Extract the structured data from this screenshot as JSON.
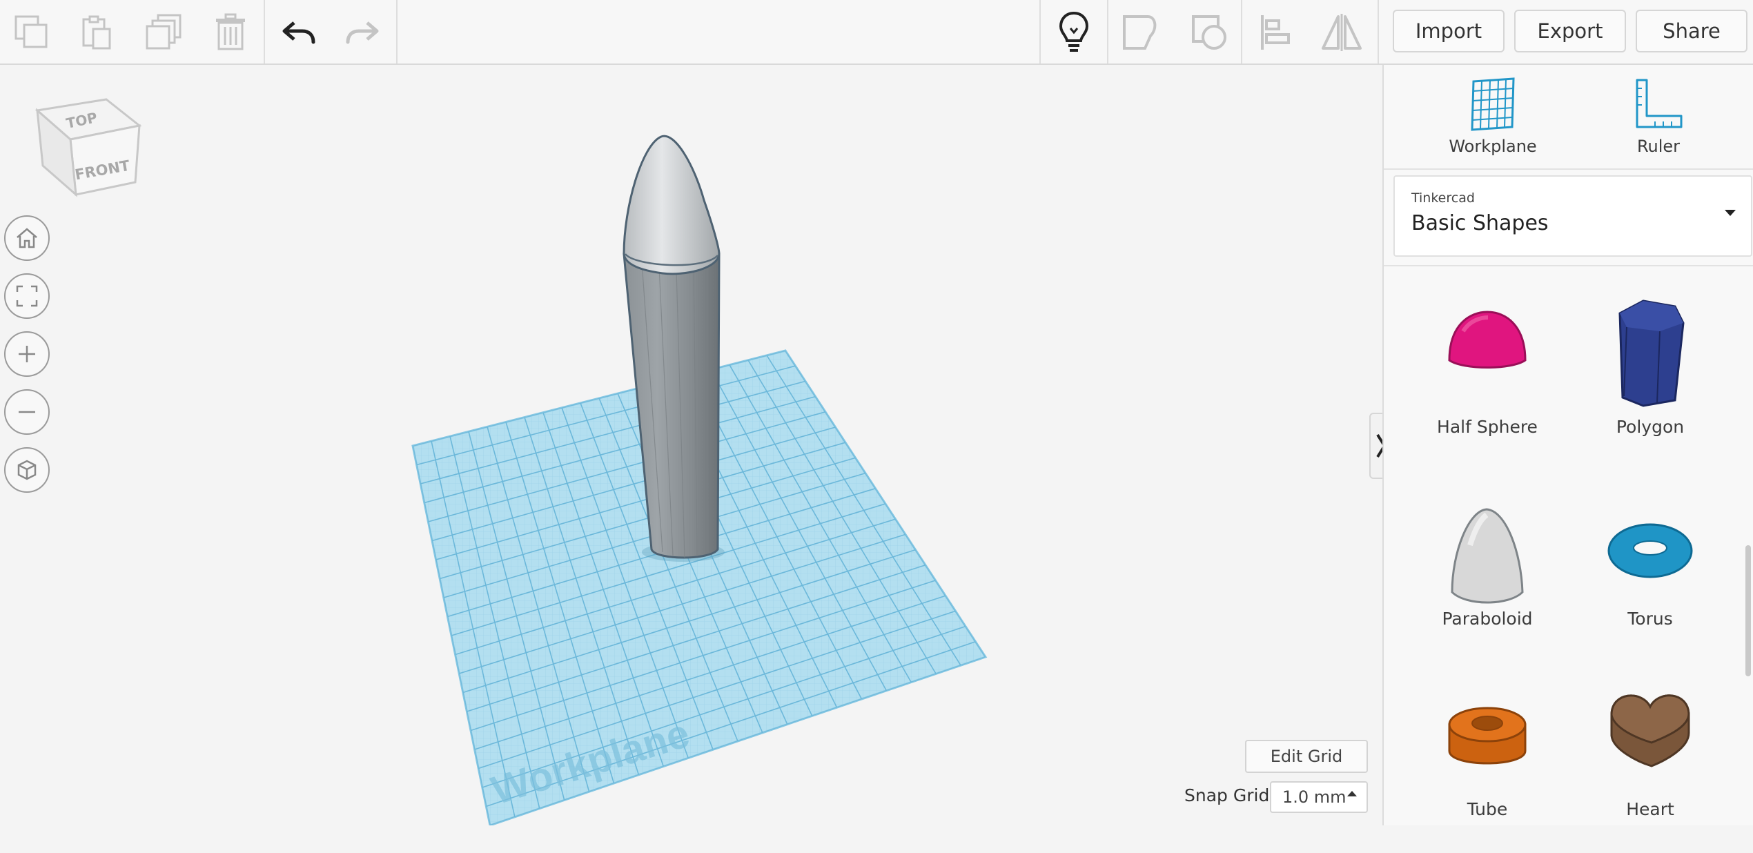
{
  "toolbar": {
    "import_label": "Import",
    "export_label": "Export",
    "share_label": "Share"
  },
  "viewcube": {
    "top_label": "TOP",
    "front_label": "FRONT"
  },
  "workplane": {
    "label": "Workplane"
  },
  "grid_controls": {
    "edit_grid_label": "Edit Grid",
    "snap_grid_label": "Snap Grid",
    "snap_grid_value": "1.0 mm"
  },
  "panel": {
    "workplane_label": "Workplane",
    "ruler_label": "Ruler",
    "library": {
      "provider": "Tinkercad",
      "name": "Basic Shapes"
    },
    "shapes": [
      {
        "label": "Half Sphere",
        "color": "#e0157f"
      },
      {
        "label": "Polygon",
        "color": "#2d3f8f"
      },
      {
        "label": "Paraboloid",
        "color": "#d8d8d8"
      },
      {
        "label": "Torus",
        "color": "#1f95c6"
      },
      {
        "label": "Tube",
        "color": "#e2731c"
      },
      {
        "label": "Heart",
        "color": "#8d6648"
      }
    ]
  },
  "colors": {
    "accent": "#2196c8",
    "workplane_blue": "#a8d8ee",
    "grid_line": "#7cc0de"
  }
}
